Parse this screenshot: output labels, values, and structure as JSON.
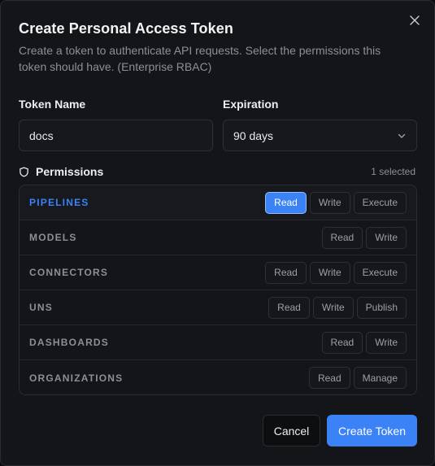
{
  "dialog": {
    "title": "Create Personal Access Token",
    "description": "Create a token to authenticate API requests. Select the permissions this token should have. (Enterprise RBAC)"
  },
  "form": {
    "token_name_label": "Token Name",
    "token_name_value": "docs",
    "expiration_label": "Expiration",
    "expiration_value": "90 days"
  },
  "permissions": {
    "title": "Permissions",
    "selected_count": "1 selected",
    "rows": [
      {
        "name": "PIPELINES",
        "active": true,
        "actions": [
          {
            "label": "Read",
            "on": true
          },
          {
            "label": "Write",
            "on": false
          },
          {
            "label": "Execute",
            "on": false
          }
        ]
      },
      {
        "name": "MODELS",
        "active": false,
        "actions": [
          {
            "label": "Read",
            "on": false
          },
          {
            "label": "Write",
            "on": false
          }
        ]
      },
      {
        "name": "CONNECTORS",
        "active": false,
        "actions": [
          {
            "label": "Read",
            "on": false
          },
          {
            "label": "Write",
            "on": false
          },
          {
            "label": "Execute",
            "on": false
          }
        ]
      },
      {
        "name": "UNS",
        "active": false,
        "actions": [
          {
            "label": "Read",
            "on": false
          },
          {
            "label": "Write",
            "on": false
          },
          {
            "label": "Publish",
            "on": false
          }
        ]
      },
      {
        "name": "DASHBOARDS",
        "active": false,
        "actions": [
          {
            "label": "Read",
            "on": false
          },
          {
            "label": "Write",
            "on": false
          }
        ]
      },
      {
        "name": "ORGANIZATIONS",
        "active": false,
        "actions": [
          {
            "label": "Read",
            "on": false
          },
          {
            "label": "Manage",
            "on": false
          }
        ]
      }
    ]
  },
  "footer": {
    "cancel_label": "Cancel",
    "create_label": "Create Token"
  },
  "icons": {
    "close": "close-icon",
    "chevron": "chevron-down-icon",
    "shield": "shield-icon"
  },
  "colors": {
    "accent": "#3b82f6",
    "background": "#141519",
    "muted_text": "#8b8f98"
  }
}
